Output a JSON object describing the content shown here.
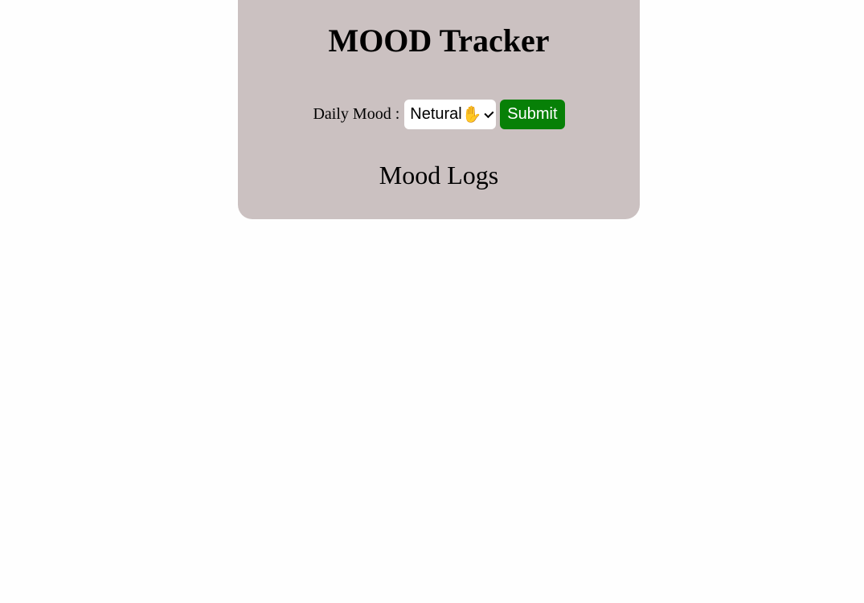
{
  "app": {
    "title": "MOOD Tracker"
  },
  "mood_form": {
    "label": "Daily Mood :",
    "selected_value": "Netural",
    "selected_icon": "hand-emoji-icon",
    "submit_label": "Submit"
  },
  "logs": {
    "title": "Mood Logs"
  },
  "colors": {
    "card_background": "#cbc1c1",
    "submit_background": "#078007",
    "submit_text": "#ffffff",
    "page_background": "#fefefe"
  }
}
